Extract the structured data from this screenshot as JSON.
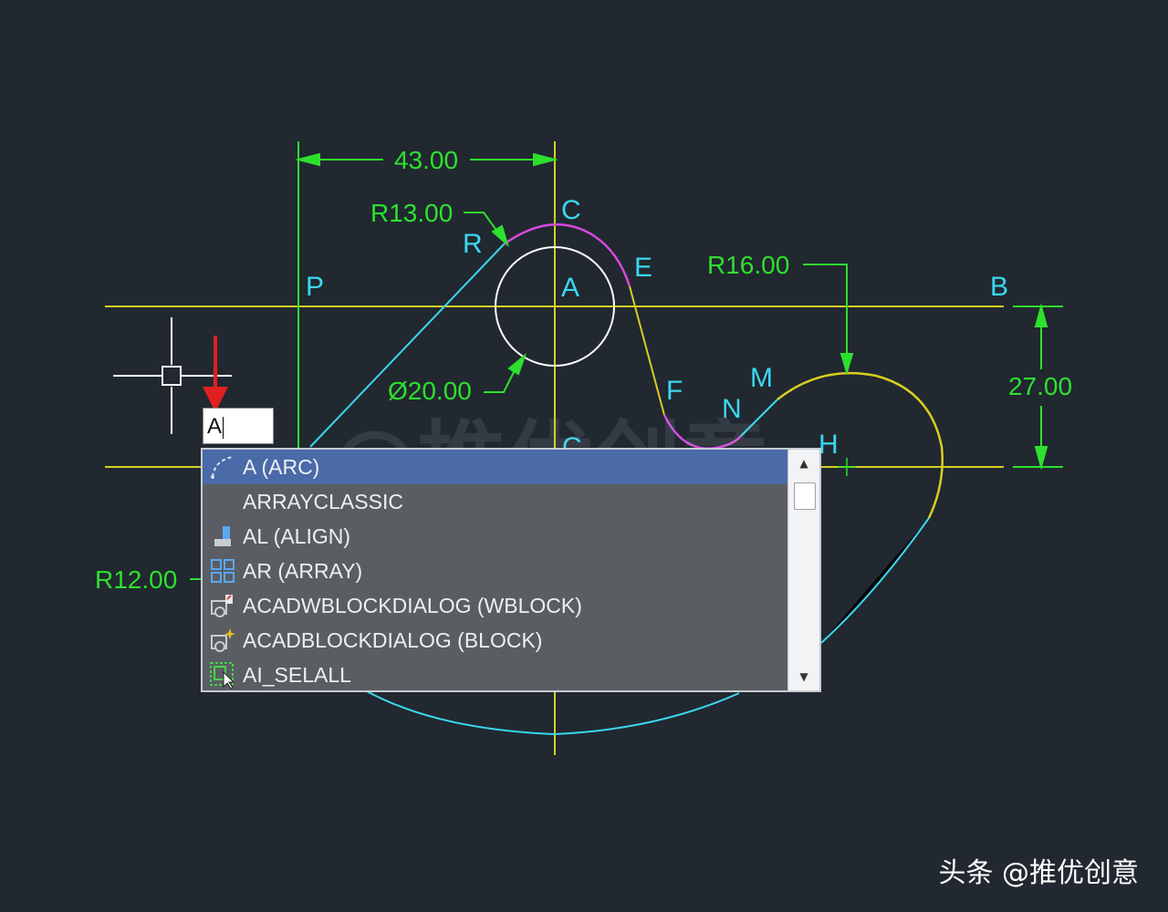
{
  "drawing": {
    "dimensions": {
      "top_width": "43.00",
      "top_arc_radius": "R13.00",
      "right_arc_radius": "R16.00",
      "right_height": "27.00",
      "circle_diameter": "Ø20.00",
      "left_radius": "R12.00"
    },
    "points": {
      "C": "C",
      "A": "A",
      "E": "E",
      "B": "B",
      "P": "P",
      "R": "R",
      "F": "F",
      "M": "M",
      "N": "N",
      "H": "H",
      "G": "C"
    },
    "watermark": "@推优创意",
    "colors": {
      "background": "#212830",
      "centerline": "#d6cf22",
      "dimension": "#2ee02e",
      "cyan_line": "#3ad8ef",
      "magenta_arc": "#d84ae0",
      "yellow_arc": "#d6cf22",
      "circle": "#ffffff",
      "arrow": "#e02020"
    }
  },
  "command_line": {
    "input_value": "A"
  },
  "autocomplete": {
    "items": [
      {
        "label": "A (ARC)",
        "icon": "arc-icon",
        "selected": true
      },
      {
        "label": "ARRAYCLASSIC",
        "icon": "",
        "selected": false
      },
      {
        "label": "AL (ALIGN)",
        "icon": "align-icon",
        "selected": false
      },
      {
        "label": "AR (ARRAY)",
        "icon": "array-icon",
        "selected": false
      },
      {
        "label": "ACADWBLOCKDIALOG (WBLOCK)",
        "icon": "wblock-icon",
        "selected": false
      },
      {
        "label": "ACADBLOCKDIALOG (BLOCK)",
        "icon": "block-icon",
        "selected": false
      },
      {
        "label": "AI_SELALL",
        "icon": "select-all-icon",
        "selected": false
      }
    ],
    "scroll_up": "▲",
    "scroll_down": "▼"
  },
  "footer": {
    "brand": "头条 @推优创意"
  }
}
